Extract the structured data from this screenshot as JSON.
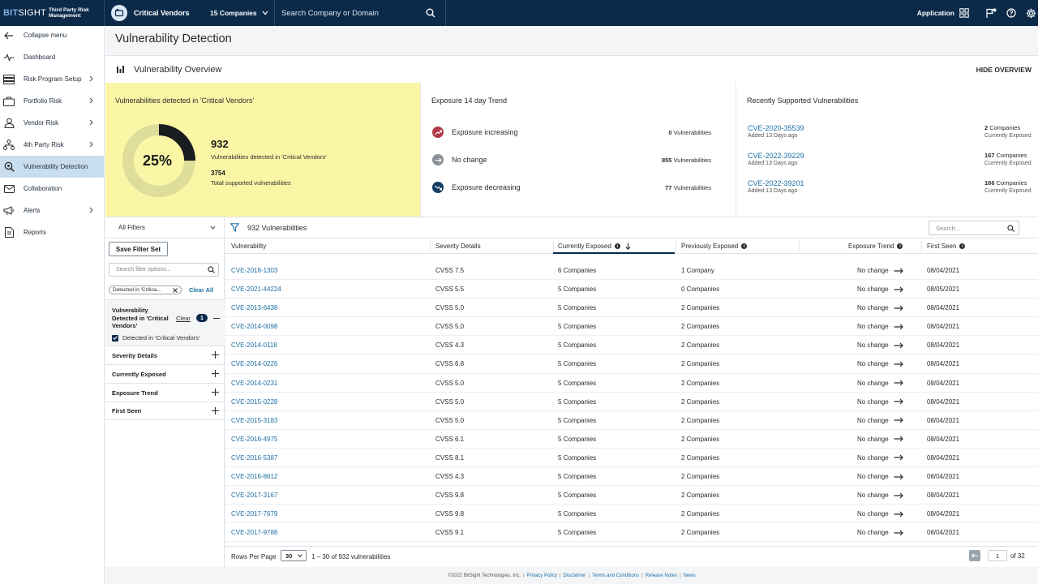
{
  "app": {
    "logo_bit": "BIT",
    "logo_sight": "SIGHT",
    "logo_sub": "Third Party Risk Management",
    "vendor_name": "Critical Vendors",
    "vendor_count": "15 Companies",
    "search_placeholder": "Search Company or Domain",
    "application_label": "Application"
  },
  "sidebar": {
    "items": [
      {
        "label": "Collapse menu"
      },
      {
        "label": "Dashboard"
      },
      {
        "label": "Risk Program Setup"
      },
      {
        "label": "Portfolio Risk"
      },
      {
        "label": "Vendor Risk"
      },
      {
        "label": "4th Party Risk"
      },
      {
        "label": "Vulnerability Detection"
      },
      {
        "label": "Collaboration"
      },
      {
        "label": "Alerts"
      },
      {
        "label": "Reports"
      }
    ]
  },
  "page": {
    "title": "Vulnerability Detection",
    "overview_title": "Vulnerability Overview",
    "hide_overview": "HIDE OVERVIEW"
  },
  "detected": {
    "title": "Vulnerabilities detected in 'Critical Vendors'",
    "percent_label": "25%",
    "percent_value": 0.25,
    "count": "932",
    "count_label": "Vulnerabilities detected in 'Critical Vendors'",
    "total": "3754",
    "total_label": "Total supported vulnerabilities"
  },
  "trend": {
    "title": "Exposure 14 day Trend",
    "rows": [
      {
        "label": "Exposure increasing",
        "value": "0",
        "unit": "Vulnerabilities",
        "color": "#b03a48"
      },
      {
        "label": "No change",
        "value": "855",
        "unit": "Vulnerabilities",
        "color": "#8a9097"
      },
      {
        "label": "Exposure decreasing",
        "value": "77",
        "unit": "Vulnerabilities",
        "color": "#123c63"
      }
    ]
  },
  "recent": {
    "title": "Recently Supported Vulnerabilities",
    "rows": [
      {
        "cve": "CVE-2020-35539",
        "added": "Added 13 Days ago",
        "companies": "2",
        "companies_unit": "Companies",
        "exposed": "Currently Exposed"
      },
      {
        "cve": "CVE-2022-39229",
        "added": "Added 13 Days ago",
        "companies": "167",
        "companies_unit": "Companies",
        "exposed": "Currently Exposed"
      },
      {
        "cve": "CVE-2022-39201",
        "added": "Added 13 Days ago",
        "companies": "166",
        "companies_unit": "Companies",
        "exposed": "Currently Exposed"
      }
    ]
  },
  "filters": {
    "all_filters": "All Filters",
    "vuln_count": "932 Vulnerabilities",
    "table_search_placeholder": "Search...",
    "save_filter_set": "Save Filter Set",
    "search_placeholder": "Search filter options...",
    "chip": "Detected in 'Critica...",
    "clear_all": "Clear All",
    "group_title": "Vulnerability Detected in 'Critical Vendors'",
    "group_clear": "Clear",
    "group_count": "1",
    "group_option": "Detected in 'Critical Vendors'",
    "rows": [
      {
        "label": "Severity Details"
      },
      {
        "label": "Currently Exposed"
      },
      {
        "label": "Exposure Trend"
      },
      {
        "label": "First Seen"
      }
    ]
  },
  "table": {
    "columns": [
      {
        "label": "Vulnerability"
      },
      {
        "label": "Severity Details"
      },
      {
        "label": "Currently Exposed"
      },
      {
        "label": "Previously Exposed"
      },
      {
        "label": "Exposure Trend"
      },
      {
        "label": "First Seen"
      }
    ],
    "rows": [
      {
        "cve": "CVE-2018-1303",
        "severity": "CVSS 7.5",
        "current": "6 Companies",
        "previous": "1 Company",
        "trend": "No change",
        "first_seen": "08/04/2021"
      },
      {
        "cve": "CVE-2021-44224",
        "severity": "CVSS 5.5",
        "current": "5 Companies",
        "previous": "0 Companies",
        "trend": "No change",
        "first_seen": "08/05/2021"
      },
      {
        "cve": "CVE-2013-6438",
        "severity": "CVSS 5.0",
        "current": "5 Companies",
        "previous": "2 Companies",
        "trend": "No change",
        "first_seen": "08/04/2021"
      },
      {
        "cve": "CVE-2014-0098",
        "severity": "CVSS 5.0",
        "current": "5 Companies",
        "previous": "2 Companies",
        "trend": "No change",
        "first_seen": "08/04/2021"
      },
      {
        "cve": "CVE-2014-0118",
        "severity": "CVSS 4.3",
        "current": "5 Companies",
        "previous": "2 Companies",
        "trend": "No change",
        "first_seen": "08/04/2021"
      },
      {
        "cve": "CVE-2014-0226",
        "severity": "CVSS 6.8",
        "current": "5 Companies",
        "previous": "2 Companies",
        "trend": "No change",
        "first_seen": "08/04/2021"
      },
      {
        "cve": "CVE-2014-0231",
        "severity": "CVSS 5.0",
        "current": "5 Companies",
        "previous": "2 Companies",
        "trend": "No change",
        "first_seen": "08/04/2021"
      },
      {
        "cve": "CVE-2015-0228",
        "severity": "CVSS 5.0",
        "current": "5 Companies",
        "previous": "2 Companies",
        "trend": "No change",
        "first_seen": "08/04/2021"
      },
      {
        "cve": "CVE-2015-3183",
        "severity": "CVSS 5.0",
        "current": "5 Companies",
        "previous": "2 Companies",
        "trend": "No change",
        "first_seen": "08/04/2021"
      },
      {
        "cve": "CVE-2016-4975",
        "severity": "CVSS 6.1",
        "current": "5 Companies",
        "previous": "2 Companies",
        "trend": "No change",
        "first_seen": "08/04/2021"
      },
      {
        "cve": "CVE-2016-5387",
        "severity": "CVSS 8.1",
        "current": "5 Companies",
        "previous": "2 Companies",
        "trend": "No change",
        "first_seen": "08/04/2021"
      },
      {
        "cve": "CVE-2016-8612",
        "severity": "CVSS 4.3",
        "current": "5 Companies",
        "previous": "2 Companies",
        "trend": "No change",
        "first_seen": "08/04/2021"
      },
      {
        "cve": "CVE-2017-3167",
        "severity": "CVSS 9.8",
        "current": "5 Companies",
        "previous": "2 Companies",
        "trend": "No change",
        "first_seen": "08/04/2021"
      },
      {
        "cve": "CVE-2017-7679",
        "severity": "CVSS 9.8",
        "current": "5 Companies",
        "previous": "2 Companies",
        "trend": "No change",
        "first_seen": "08/04/2021"
      },
      {
        "cve": "CVE-2017-9788",
        "severity": "CVSS 9.1",
        "current": "5 Companies",
        "previous": "2 Companies",
        "trend": "No change",
        "first_seen": "08/04/2021"
      }
    ]
  },
  "pager": {
    "rows_per_page": "Rows Per Page",
    "page_size": "30",
    "range": "1 – 30 of 932 vulnerabilities",
    "page": "1",
    "of_pages": "of 32"
  },
  "footer": {
    "copyright": "©2022 BitSight Technologies, Inc.",
    "links": [
      "Privacy Policy",
      "Disclaimer",
      "Terms and Conditions",
      "Release Notes",
      "News"
    ]
  },
  "colors": {
    "topbar": "#0b2a4a",
    "link": "#1d6fa5",
    "highlight": "#faf6a6",
    "active_nav": "#c8deef"
  }
}
